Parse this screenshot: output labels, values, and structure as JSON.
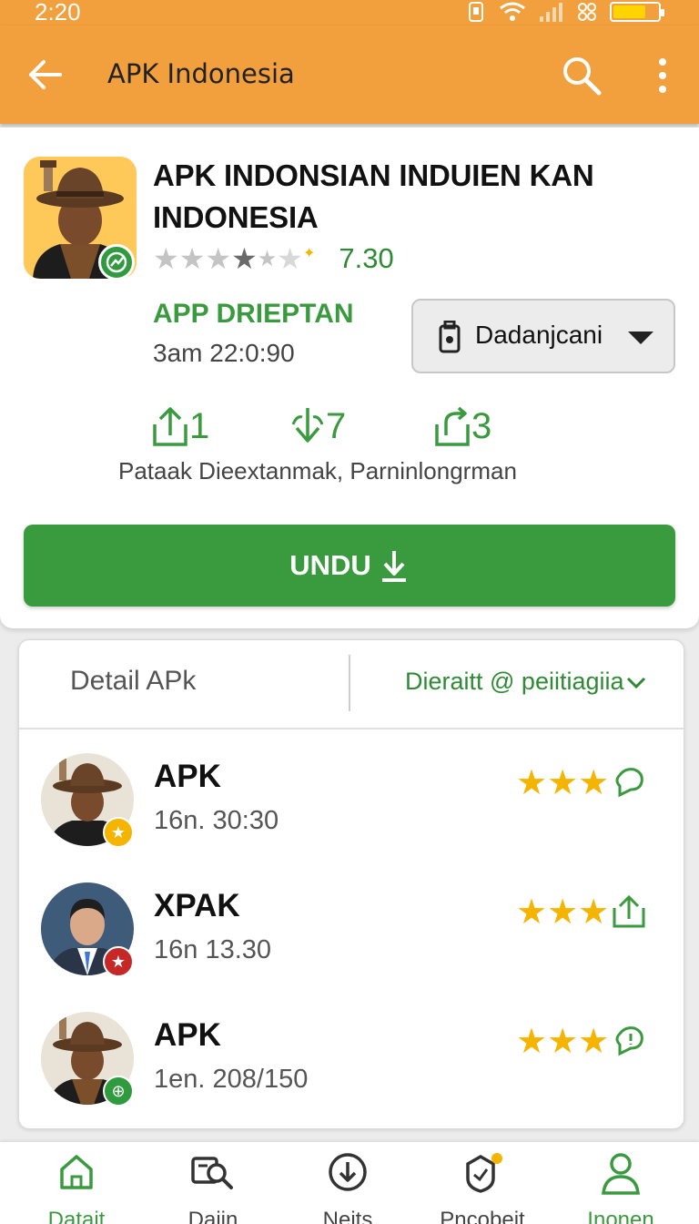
{
  "status_bar": {
    "time": "2:20",
    "battery_level": 0.75
  },
  "app_bar": {
    "title": "APK Indonesia"
  },
  "app": {
    "name": "APK INDONSIAN INDUIEN KAN INDONESIA",
    "rating_stars": 3.5,
    "rating_value": "7.30",
    "developer_label": "APP DRIEPTAN",
    "developer_date": "3am 22:0:90",
    "dropdown_label": "Dadanjcani"
  },
  "stats": {
    "items": [
      {
        "value": "1",
        "icon": "upload-tray-icon"
      },
      {
        "value": "7",
        "icon": "download-arrow-icon"
      },
      {
        "value": "3",
        "icon": "share-tray-icon"
      }
    ],
    "caption": "Pataak  Dieextanmak, Parninlongrman"
  },
  "download_button": {
    "label": "UNDU",
    "icon": "download-icon"
  },
  "detail": {
    "tab_left": "Detail APk",
    "tab_right": "Dieraitt @ peiitiagiia",
    "items": [
      {
        "title": "APK",
        "subtitle": "16n. 30:30",
        "stars": 3,
        "badge_color": "#f4b400",
        "badge_icon": "star-icon",
        "action_icon": "chat-icon"
      },
      {
        "title": "XPAK",
        "subtitle": "16n  13.30",
        "stars": 3,
        "badge_color": "#c62828",
        "badge_icon": "star-icon",
        "action_icon": "share-icon"
      },
      {
        "title": "APK",
        "subtitle": "1en. 208/150",
        "stars": 3,
        "badge_color": "#2f9a3e",
        "badge_icon": "plus-icon",
        "action_icon": "info-chat-icon"
      }
    ]
  },
  "bottom_nav": {
    "items": [
      {
        "label": "Datait",
        "icon": "home-icon",
        "active": true
      },
      {
        "label": "Daiin",
        "icon": "search-image-icon",
        "active": false
      },
      {
        "label": "Neits",
        "icon": "download-circle-icon",
        "active": false
      },
      {
        "label": "Pncobeit",
        "icon": "badge-shield-icon",
        "active": false
      },
      {
        "label": "Inonen",
        "icon": "profile-icon",
        "active": true
      }
    ]
  },
  "colors": {
    "app_bar": "#f2a03d",
    "accent_green": "#3a9a3e",
    "star_gold": "#f4b400"
  }
}
